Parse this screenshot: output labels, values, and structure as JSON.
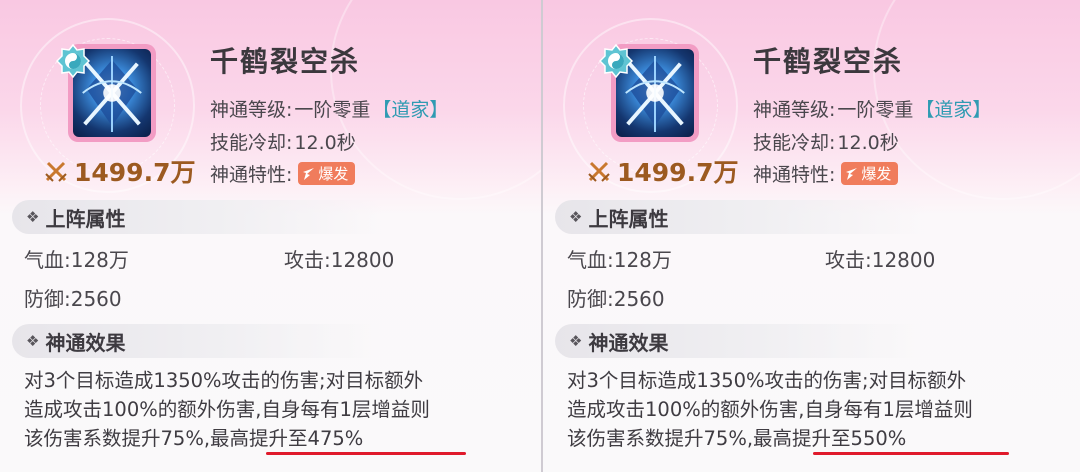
{
  "panels": [
    {
      "skill_name": "千鹤裂空杀",
      "power": "1499.7万",
      "level_label": "神通等级:",
      "level_value": "一阶零重",
      "school": "【道家】",
      "cooldown_label": "技能冷却:",
      "cooldown_value": "12.0秒",
      "trait_label": "神通特性:",
      "trait_tag": "爆发",
      "attr_section": "上阵属性",
      "hp": "气血:128万",
      "atk": "攻击:12800",
      "def": "防御:2560",
      "effect_section": "神通效果",
      "effect_line1": "对3个目标造成1350%攻击的伤害;对目标额外",
      "effect_line2": "造成攻击100%的额外伤害,自身每有1层增益则",
      "effect_line3a": "该伤害系数提升75%,",
      "effect_line3b": "最高提升至475%"
    },
    {
      "skill_name": "千鹤裂空杀",
      "power": "1499.7万",
      "level_label": "神通等级:",
      "level_value": "一阶零重",
      "school": "【道家】",
      "cooldown_label": "技能冷却:",
      "cooldown_value": "12.0秒",
      "trait_label": "神通特性:",
      "trait_tag": "爆发",
      "attr_section": "上阵属性",
      "hp": "气血:128万",
      "atk": "攻击:12800",
      "def": "防御:2560",
      "effect_section": "神通效果",
      "effect_line1": "对3个目标造成1350%攻击的伤害;对目标额外",
      "effect_line2": "造成攻击100%的额外伤害,自身每有1层增益则",
      "effect_line3a": "该伤害系数提升75%,",
      "effect_line3b": "最高提升至550%"
    }
  ],
  "colors": {
    "header_pink": "#f9c8e2",
    "power_brown": "#9c5a20",
    "school_teal": "#2f9bb2",
    "tag_orange": "#f07c5c",
    "underline_red": "#e01a2b"
  },
  "icons": {
    "skill": "crossed-swords-skill-icon",
    "badge": "tao-school-badge-icon",
    "power": "crossed-swords-power-icon",
    "tag": "burst-icon",
    "section": "diamond-bullet-icon"
  }
}
